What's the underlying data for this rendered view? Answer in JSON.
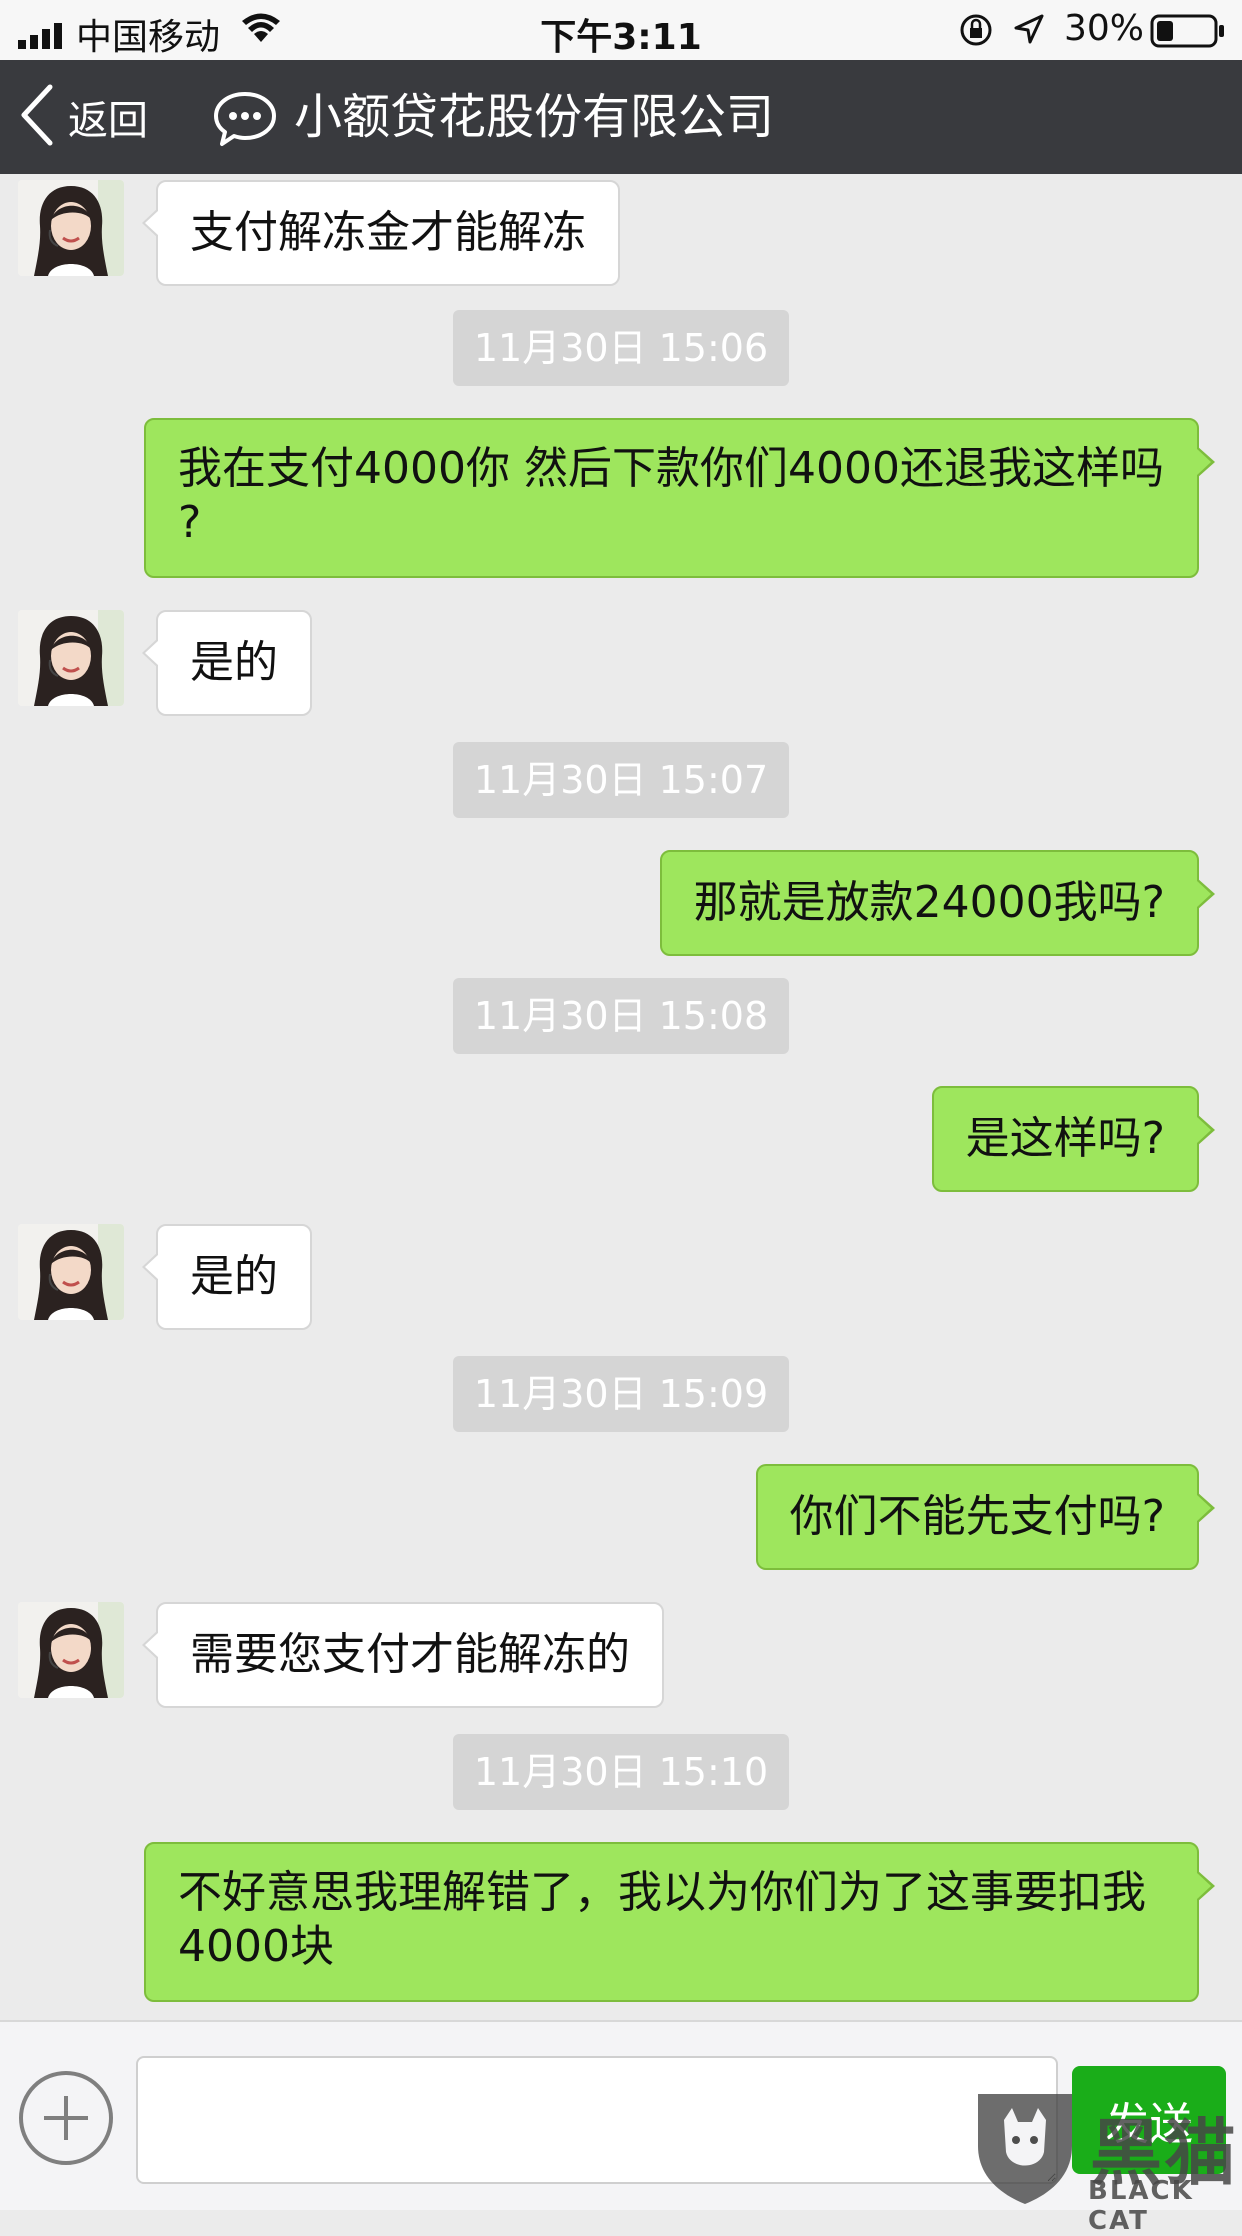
{
  "status_bar": {
    "carrier": "中国移动",
    "time": "下午3:11",
    "battery_percent": "30%",
    "battery_level": 0.3
  },
  "nav": {
    "back_label": "返回",
    "title": "小额贷花股份有限公司"
  },
  "messages": [
    {
      "type": "in",
      "text": "支付解冻金才能解冻"
    },
    {
      "type": "time",
      "text": "11月30日 15:06"
    },
    {
      "type": "out",
      "lines": [
        "我在支付4000你 然后下款你们4000还退我这样吗",
        "?"
      ]
    },
    {
      "type": "in",
      "text": "是的"
    },
    {
      "type": "time",
      "text": "11月30日 15:07"
    },
    {
      "type": "out",
      "text": "那就是放款24000我吗?"
    },
    {
      "type": "time",
      "text": "11月30日 15:08"
    },
    {
      "type": "out",
      "text": "是这样吗?"
    },
    {
      "type": "in",
      "text": "是的"
    },
    {
      "type": "time",
      "text": "11月30日 15:09"
    },
    {
      "type": "out",
      "text": "你们不能先支付吗?"
    },
    {
      "type": "in",
      "text": "需要您支付才能解冻的"
    },
    {
      "type": "time",
      "text": "11月30日 15:10"
    },
    {
      "type": "out",
      "lines": [
        "不好意思我理解错了，我以为你们为了这事要扣我",
        "4000块"
      ]
    }
  ],
  "input": {
    "value": "",
    "send_label": "发送"
  },
  "watermark": {
    "text_cn": "黑猫",
    "text_en": "BLACK CAT"
  },
  "colors": {
    "nav_bg": "#393a3e",
    "chat_bg": "#ebebeb",
    "out_bubble": "#9ee65d",
    "in_bubble": "#ffffff",
    "send_button": "#1aad19"
  }
}
